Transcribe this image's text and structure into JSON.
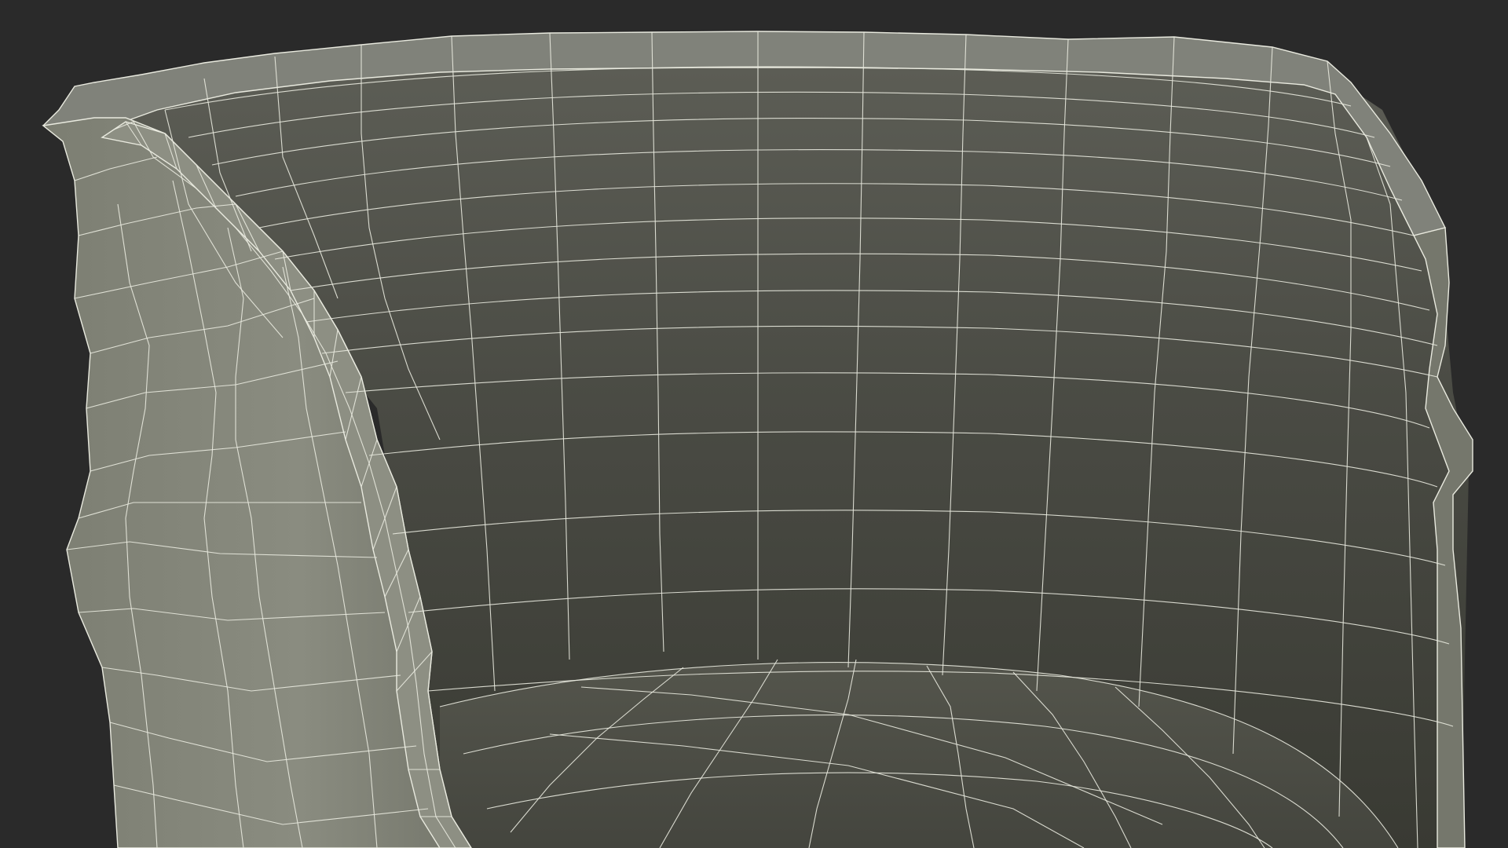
{
  "scene": {
    "subject": "wireframe-render",
    "colors": {
      "background": "#2a2a2a",
      "backrest_inner_light": "#5c5d55",
      "backrest_inner_dark": "#3b3c35",
      "rim_fill": "#7d7f74",
      "outer_shell": "#84867a",
      "outer_shell_shade": "#6f7166",
      "seat_fill": "#4d4e46",
      "wire": "#e9eadf"
    }
  }
}
